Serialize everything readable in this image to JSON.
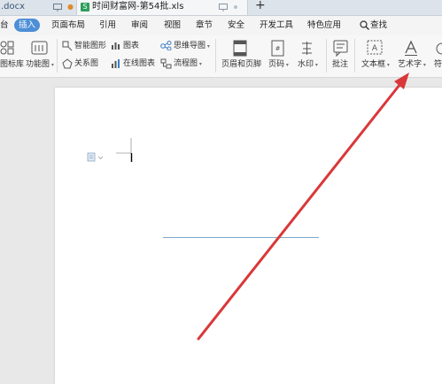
{
  "tabs": [
    {
      "label": ".docx",
      "dot": "●"
    },
    {
      "label": "时间财富网-第54批.xls"
    }
  ],
  "tab_icon_letter": "S",
  "new_tab_symbol": "+",
  "menu": [
    "插入",
    "页面布局",
    "引用",
    "审阅",
    "视图",
    "章节",
    "安全",
    "开发工具",
    "特色应用"
  ],
  "menu_left_fragment": "台",
  "search_label": "查找",
  "ribbon": {
    "icon_library": "图标库",
    "function_chart": "功能图",
    "smart_shape": "智能图形",
    "chart": "图表",
    "mind_map": "思维导图",
    "relation_chart": "关系图",
    "online_chart": "在线图表",
    "flow_chart": "流程图",
    "header_footer": "页眉和页脚",
    "page_number": "页码",
    "watermark": "水印",
    "comment": "批注",
    "text_box": "文本框",
    "art_text": "艺术字",
    "right_fragment": "符"
  },
  "colors": {
    "active_menu": "#4d8fd6",
    "arrow": "#d9383a",
    "line": "#7fa7c9"
  }
}
